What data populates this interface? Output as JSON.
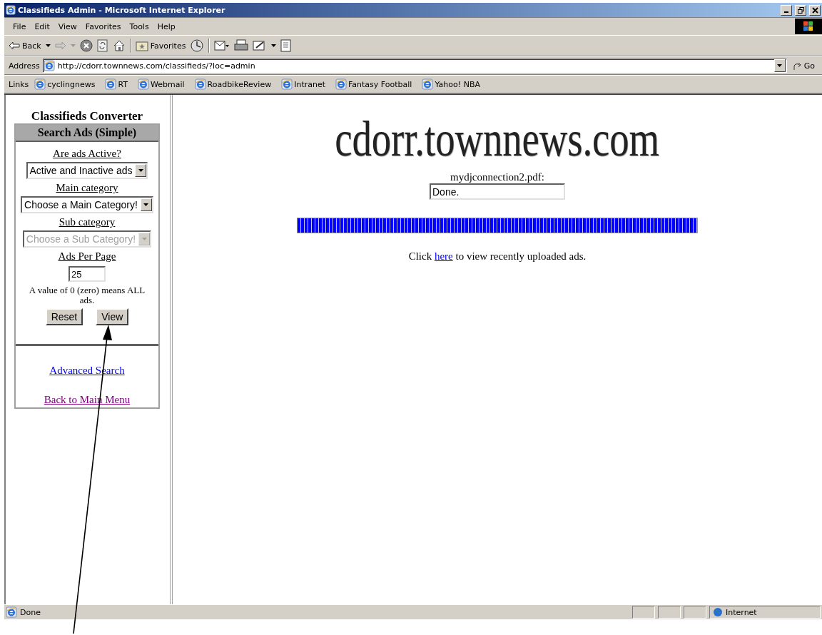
{
  "window": {
    "title": "Classifieds Admin - Microsoft Internet Explorer"
  },
  "menu": [
    "File",
    "Edit",
    "View",
    "Favorites",
    "Tools",
    "Help"
  ],
  "toolbar": {
    "back": "Back",
    "favorites": "Favorites"
  },
  "address": {
    "label": "Address",
    "value": "http://cdorr.townnews.com/classifieds/?loc=admin",
    "go": "Go"
  },
  "links": {
    "label": "Links",
    "items": [
      "cyclingnews",
      "RT",
      "Webmail",
      "RoadbikeReview",
      "Intranet",
      "Fantasy Football",
      "Yahoo! NBA"
    ]
  },
  "sidebar": {
    "title": "Classifieds Converter",
    "panel_title": "Search Ads (Simple)",
    "fields": [
      {
        "label": "Are ads Active?",
        "kind": "select",
        "value": "Active and Inactive ads",
        "disabled": false
      },
      {
        "label": "Main category",
        "kind": "select",
        "value": "Choose a Main Category!",
        "disabled": false
      },
      {
        "label": "Sub category",
        "kind": "select",
        "value": "Choose a Sub Category!",
        "disabled": true
      },
      {
        "label": "Ads Per Page",
        "kind": "text",
        "value": "25"
      }
    ],
    "note": "A value of 0 (zero) means ALL ads.",
    "buttons": [
      "Reset",
      "View"
    ],
    "links": [
      {
        "label": "Advanced Search",
        "visited": false
      },
      {
        "label": "Back to Main Menu",
        "visited": true
      }
    ]
  },
  "main": {
    "site_title": "cdorr.townnews.com",
    "file_name": "mydjconnection2.pdf:",
    "status_value": "Done.",
    "progress": {
      "level": 1
    },
    "message": {
      "before": "Click",
      "link": "here",
      "after": "to view recently uploaded ads."
    }
  },
  "status_bar": {
    "text": "Done",
    "zone": "Internet"
  }
}
